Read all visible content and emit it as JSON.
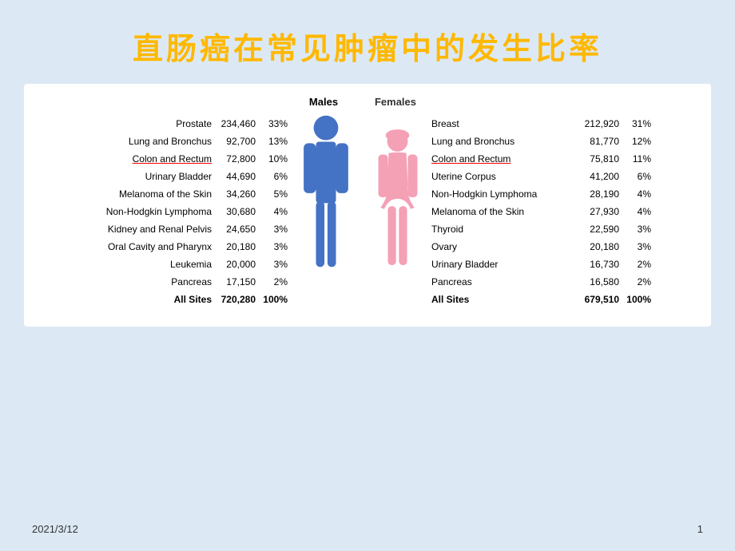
{
  "title": "直肠癌在常见肿瘤中的发生比率",
  "labels": {
    "males": "Males",
    "females": "Females"
  },
  "male_rows": [
    {
      "name": "Prostate",
      "num": "234,460",
      "pct": "33%",
      "underline": false,
      "bold": false
    },
    {
      "name": "Lung and Bronchus",
      "num": "92,700",
      "pct": "13%",
      "underline": false,
      "bold": false
    },
    {
      "name": "Colon and Rectum",
      "num": "72,800",
      "pct": "10%",
      "underline": true,
      "bold": false
    },
    {
      "name": "Urinary Bladder",
      "num": "44,690",
      "pct": "6%",
      "underline": false,
      "bold": false
    },
    {
      "name": "Melanoma of the Skin",
      "num": "34,260",
      "pct": "5%",
      "underline": false,
      "bold": false
    },
    {
      "name": "Non-Hodgkin Lymphoma",
      "num": "30,680",
      "pct": "4%",
      "underline": false,
      "bold": false
    },
    {
      "name": "Kidney and Renal Pelvis",
      "num": "24,650",
      "pct": "3%",
      "underline": false,
      "bold": false
    },
    {
      "name": "Oral Cavity and Pharynx",
      "num": "20,180",
      "pct": "3%",
      "underline": false,
      "bold": false
    },
    {
      "name": "Leukemia",
      "num": "20,000",
      "pct": "3%",
      "underline": false,
      "bold": false
    },
    {
      "name": "Pancreas",
      "num": "17,150",
      "pct": "2%",
      "underline": false,
      "bold": false
    },
    {
      "name": "All Sites",
      "num": "720,280",
      "pct": "100%",
      "underline": false,
      "bold": true
    }
  ],
  "female_rows": [
    {
      "name": "Breast",
      "num": "212,920",
      "pct": "31%",
      "underline": false,
      "bold": false
    },
    {
      "name": "Lung and Bronchus",
      "num": "81,770",
      "pct": "12%",
      "underline": false,
      "bold": false
    },
    {
      "name": "Colon and Rectum",
      "num": "75,810",
      "pct": "11%",
      "underline": true,
      "bold": false
    },
    {
      "name": "Uterine Corpus",
      "num": "41,200",
      "pct": "6%",
      "underline": false,
      "bold": false
    },
    {
      "name": "Non-Hodgkin Lymphoma",
      "num": "28,190",
      "pct": "4%",
      "underline": false,
      "bold": false
    },
    {
      "name": "Melanoma of the Skin",
      "num": "27,930",
      "pct": "4%",
      "underline": false,
      "bold": false
    },
    {
      "name": "Thyroid",
      "num": "22,590",
      "pct": "3%",
      "underline": false,
      "bold": false
    },
    {
      "name": "Ovary",
      "num": "20,180",
      "pct": "3%",
      "underline": false,
      "bold": false
    },
    {
      "name": "Urinary Bladder",
      "num": "16,730",
      "pct": "2%",
      "underline": false,
      "bold": false
    },
    {
      "name": "Pancreas",
      "num": "16,580",
      "pct": "2%",
      "underline": false,
      "bold": false
    },
    {
      "name": "All Sites",
      "num": "679,510",
      "pct": "100%",
      "underline": false,
      "bold": true
    }
  ],
  "footer": {
    "date": "2021/3/12",
    "page": "1"
  }
}
